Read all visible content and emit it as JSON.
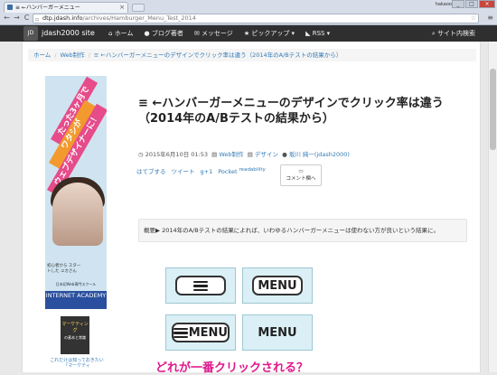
{
  "browser": {
    "tab_title": "≡ ←ハンバーガーメニュー",
    "tab_close": "×",
    "user": "hakaoo",
    "url_host": "dtp.jdash.info",
    "url_path": "/archives/Hamburger_Menu_Test_2014",
    "back": "←",
    "forward": "→",
    "reload": "C",
    "star": "☆",
    "menu": "≡",
    "win_min": "_",
    "win_max": "□",
    "win_close": "×"
  },
  "site": {
    "logo_text": "JD",
    "brand": "jdash2000 site",
    "nav": [
      {
        "icon": "home-icon",
        "label": "ホーム"
      },
      {
        "icon": "user-icon",
        "label": "ブログ著者"
      },
      {
        "icon": "envelope-icon",
        "label": "メッセージ"
      },
      {
        "icon": "star-icon",
        "label": "ピックアップ ▾"
      },
      {
        "icon": "rss-icon",
        "label": "RSS ▾"
      }
    ],
    "search": "サイト内検索"
  },
  "breadcrumb": [
    "ホーム",
    "Web制作",
    "≡ ←ハンバーガーメニューのデザインでクリック率は違う（2014年のA/Bテストの結果から）"
  ],
  "sidebar": {
    "banner_lines": [
      "たった3ヶ月で",
      "ワタシが",
      "ウェブデザイナーに！"
    ],
    "banner_tagline": "初心者から スタートした ユカさん",
    "banner_school": "日本初Web専門スクール",
    "banner_name": "INTERNET ACADEMY",
    "book_title": "マーケティング",
    "book_sub": "の基本と常識",
    "book_caption": "これだけは知っておきたい「マーケティ"
  },
  "article": {
    "title": "≡ ←ハンバーガーメニューのデザインでクリック率は違う（2014年のA/Bテストの結果から）",
    "date": "2015年6月10日 01:53",
    "category": "Web制作",
    "tag": "デザイン",
    "author": "坂川 純一(jdash2000)",
    "share": [
      "はてブする",
      "ツイート",
      "g+1",
      "Pocket"
    ],
    "share_sup": "readability",
    "comment": "コメント欄へ",
    "summary": "概要▶ 2014年のA/Bテストの結果によれば、いわゆるハンバーガーメニューは使わない方が良いという結果に。",
    "buttons": {
      "b2": "MENU",
      "b3": "MENU",
      "b4": "MENU"
    },
    "question": "どれが一番クリックされる？"
  }
}
